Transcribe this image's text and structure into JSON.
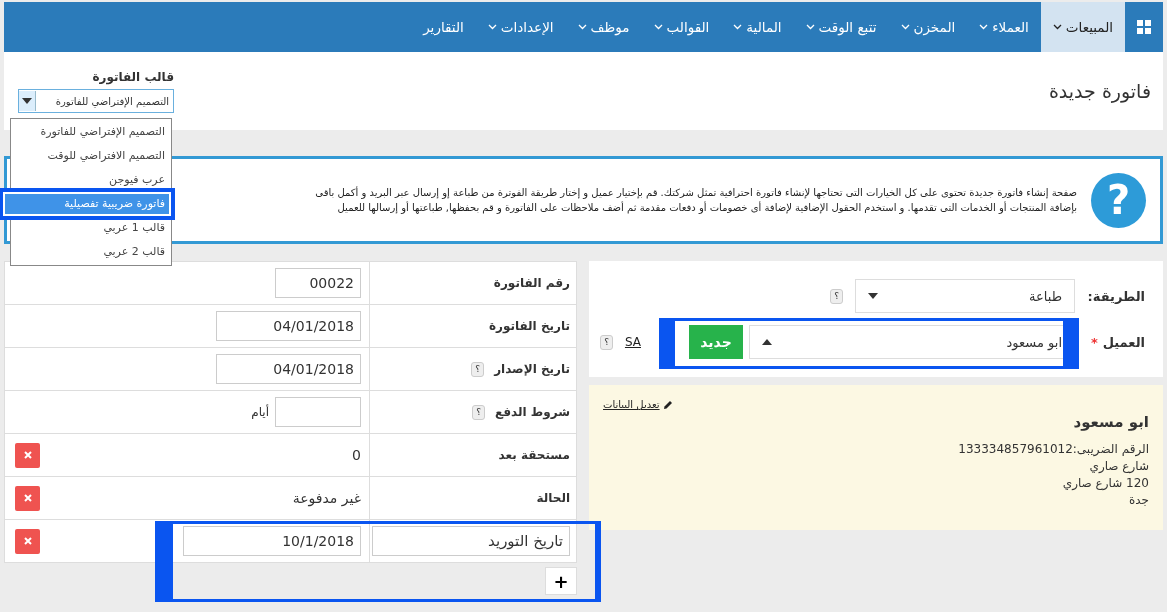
{
  "nav": {
    "items": [
      {
        "label": "المبيعات",
        "selected": true,
        "has_menu": true
      },
      {
        "label": "العملاء",
        "selected": false,
        "has_menu": true
      },
      {
        "label": "المخزن",
        "selected": false,
        "has_menu": true
      },
      {
        "label": "تتبع الوقت",
        "selected": false,
        "has_menu": true
      },
      {
        "label": "المالية",
        "selected": false,
        "has_menu": true
      },
      {
        "label": "القوالب",
        "selected": false,
        "has_menu": true
      },
      {
        "label": "موظف",
        "selected": false,
        "has_menu": true
      },
      {
        "label": "الإعدادات",
        "selected": false,
        "has_menu": true
      },
      {
        "label": "التقارير",
        "selected": false,
        "has_menu": false
      }
    ]
  },
  "page_title": "فاتورة جديدة",
  "template": {
    "label": "قالب الفاتورة",
    "value": "التصميم الإفتراضي للفاتورة",
    "expanded": true,
    "options": [
      {
        "label": "التصميم الإفتراضي للفاتورة",
        "highlighted": false
      },
      {
        "label": "التصميم الافتراضي للوقت",
        "highlighted": false
      },
      {
        "label": "عرب فيوجن",
        "highlighted": false
      },
      {
        "label": "فاتورة ضريبية تفصيلية",
        "highlighted": true
      },
      {
        "label": "قالب 1 عربي",
        "highlighted": false
      },
      {
        "label": "قالب 2 عربي",
        "highlighted": false
      }
    ]
  },
  "info": {
    "icon": "?",
    "lines": [
      "صفحة إنشاء فاتورة جديدة تحتوى على كل الخيارات التى تحتاجها لإنشاء فاتورة احترافية تمثل شركتك. قم بإختيار عميل و إختار طريقة الفوترة من طباعة إو إرسال عبر البريد و أكمل باقى",
      "بإضافة المنتجات أو الخدمات التى تقدمها. و استخدم الحقول الإضافية لإضافة أى خصومات أو دفعات مقدمة ثم أضف ملاحظات على الفاتورة و قم بحفظها, طباعتها أو إرسالها للعميل"
    ]
  },
  "invoice_fields": [
    {
      "kind": "short_input",
      "label": "رقم الفاتورة",
      "value": "00022"
    },
    {
      "kind": "date_input",
      "label": "تاريخ الفاتورة",
      "value": "04/01/2018"
    },
    {
      "kind": "date_input",
      "label": "تاريخ الإصدار",
      "help": "؟",
      "value": "04/01/2018"
    },
    {
      "kind": "short_input",
      "label": "شروط الدفع",
      "help": "؟",
      "suffix": "أيام"
    },
    {
      "kind": "static",
      "label": "مستحقة بعد",
      "value": "0",
      "removable": true
    },
    {
      "kind": "static",
      "label": "الحالة",
      "value": "غير مدفوعة",
      "removable": true
    },
    {
      "kind": "custom",
      "label": "تاريخ التوريد",
      "value": "10/1/2018",
      "removable": true,
      "highlighted": true
    }
  ],
  "add_field_button": "+",
  "method": {
    "label": "الطريقة:",
    "value": "طباعة",
    "help": "؟"
  },
  "client": {
    "label": "العميل",
    "required": "*",
    "value": "ابو مسعود",
    "new_button": "جديد",
    "link": "SA",
    "help": "؟",
    "highlighted": true
  },
  "client_card": {
    "edit_link": "تعديل البيانات",
    "name": "ابو مسعود",
    "lines": [
      "الرقم الضريبى:133334857961012",
      "شارع صاري",
      "120 شارع صاري",
      "جدة"
    ]
  }
}
